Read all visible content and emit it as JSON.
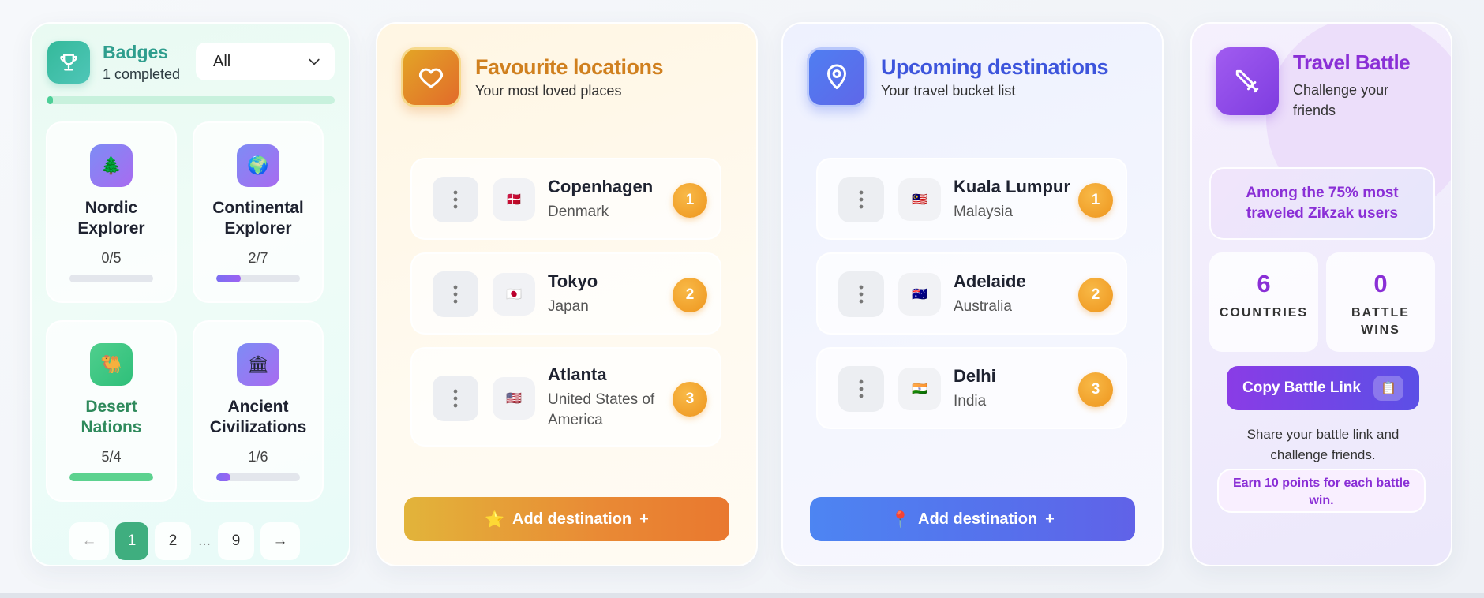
{
  "badges": {
    "title": "Badges",
    "completed_text": "1 completed",
    "filter_value": "All",
    "overall_progress": 0.02,
    "items": [
      {
        "name_line1": "Nordic",
        "name_line2": "Explorer",
        "count": "0/5",
        "progress": 0.0,
        "emoji": "🌲",
        "done": false
      },
      {
        "name_line1": "Continental",
        "name_line2": "Explorer",
        "count": "2/7",
        "progress": 0.29,
        "emoji": "🌍",
        "done": false
      },
      {
        "name_line1": "Desert",
        "name_line2": "Nations",
        "count": "5/4",
        "progress": 1.0,
        "emoji": "🐫",
        "done": true
      },
      {
        "name_line1": "Ancient",
        "name_line2": "Civilizations",
        "count": "1/6",
        "progress": 0.17,
        "emoji": "🏛",
        "done": false
      }
    ],
    "pagination": {
      "prev": "←",
      "pages": [
        "1",
        "2",
        "...",
        "9"
      ],
      "active": "1",
      "next": "→"
    }
  },
  "favourite": {
    "title": "Favourite locations",
    "subtitle": "Your most loved places",
    "items": [
      {
        "city": "Copenhagen",
        "country": "Denmark",
        "flag": "🇩🇰",
        "rank": "1"
      },
      {
        "city": "Tokyo",
        "country": "Japan",
        "flag": "🇯🇵",
        "rank": "2"
      },
      {
        "city": "Atlanta",
        "country_line1": "United States of",
        "country_line2": "America",
        "flag": "🇺🇸",
        "rank": "3"
      }
    ],
    "add_button": {
      "icon": "⭐",
      "label": "Add destination",
      "suffix": "+"
    }
  },
  "upcoming": {
    "title": "Upcoming destinations",
    "subtitle": "Your travel bucket list",
    "items": [
      {
        "city": "Kuala Lumpur",
        "country": "Malaysia",
        "flag": "🇲🇾",
        "rank": "1"
      },
      {
        "city": "Adelaide",
        "country": "Australia",
        "flag": "🇦🇺",
        "rank": "2"
      },
      {
        "city": "Delhi",
        "country": "India",
        "flag": "🇮🇳",
        "rank": "3"
      }
    ],
    "add_button": {
      "icon": "📍",
      "label": "Add destination",
      "suffix": "+"
    }
  },
  "battle": {
    "title": "Travel Battle",
    "subtitle": "Challenge your friends",
    "rank_line1": "Among the 75% most",
    "rank_line2": "traveled Zikzak users",
    "stats": [
      {
        "value": "6",
        "label_line1": "COUNTRIES",
        "label_line2": ""
      },
      {
        "value": "0",
        "label_line1": "BATTLE",
        "label_line2": "WINS"
      }
    ],
    "copy_button": "Copy Battle Link",
    "copy_icon": "📋",
    "share_line1": "Share your battle link and",
    "share_line2": "challenge friends.",
    "earn_line1": "Earn 10 points for each battle",
    "earn_line2": "win."
  },
  "colors": {
    "badges_accent": "#2f9e8e",
    "favourite_accent": "#d0801f",
    "upcoming_accent": "#3d55dc",
    "battle_accent": "#8a2fd6",
    "rank_badge": "#ee951d"
  }
}
